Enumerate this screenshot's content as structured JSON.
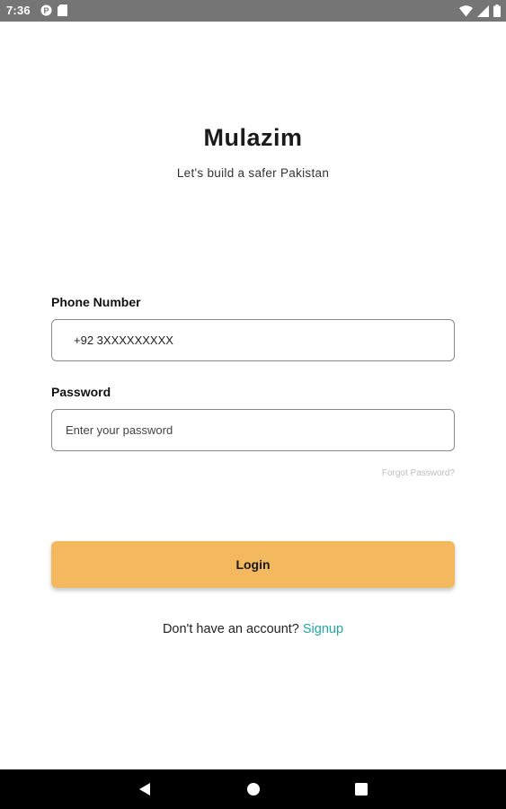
{
  "status_bar": {
    "time": "7:36",
    "left_icons": [
      "p-notification-icon",
      "sd-card-icon"
    ],
    "right_icons": [
      "wifi-icon",
      "signal-icon",
      "battery-icon"
    ]
  },
  "header": {
    "title": "Mulazim",
    "tagline": "Let's build a safer Pakistan"
  },
  "form": {
    "phone": {
      "label": "Phone Number",
      "value": "+92 3XXXXXXXXX",
      "placeholder": ""
    },
    "password": {
      "label": "Password",
      "value": "",
      "placeholder": "Enter your password"
    },
    "forgot_password": "Forgot Password?",
    "login_label": "Login"
  },
  "signup": {
    "prompt": "Don't have an account?",
    "link": "Signup"
  },
  "nav_bar": {
    "icons": [
      "back-icon",
      "home-icon",
      "recents-icon"
    ]
  },
  "colors": {
    "status_bar": "#757575",
    "accent_button": "#f4b95f",
    "signup_link": "#21a9a0",
    "nav_bar": "#000000"
  }
}
